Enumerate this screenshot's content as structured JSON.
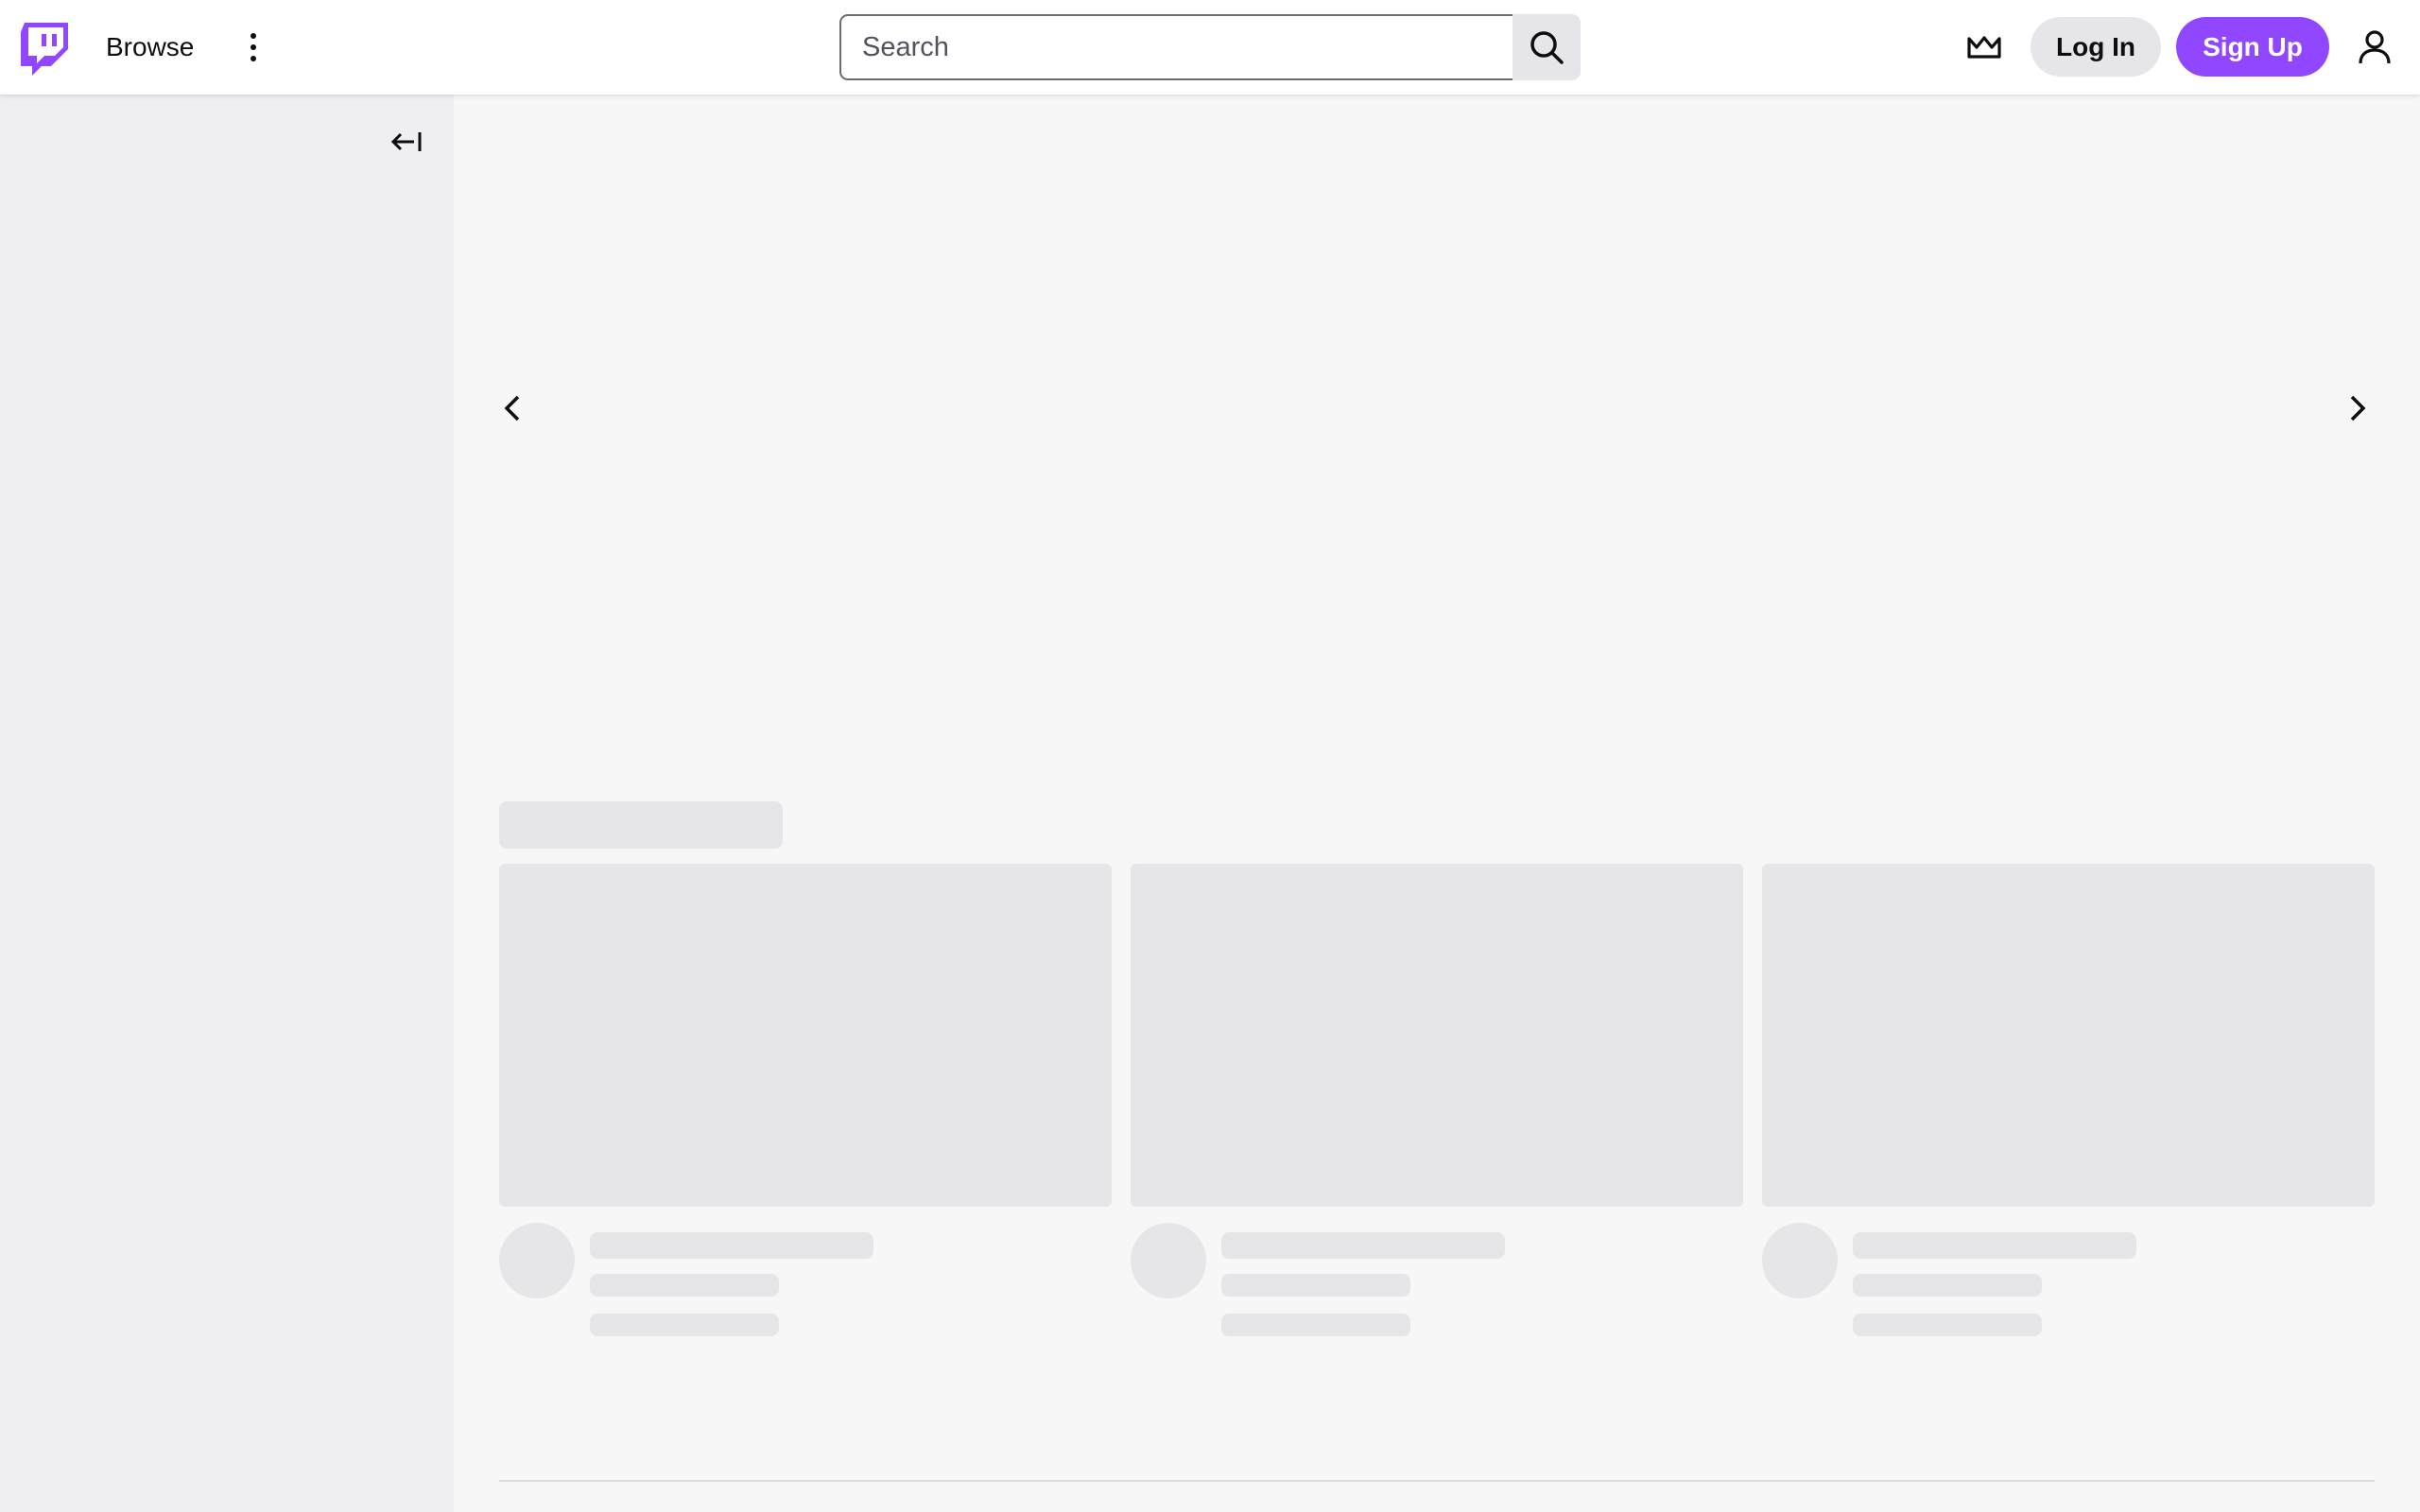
{
  "brand": {
    "accent": "#9147ff",
    "logo_icon": "twitch-logo-icon"
  },
  "header": {
    "browse_label": "Browse",
    "more_icon": "kebab-menu-icon",
    "search_placeholder": "Search",
    "search_value": "",
    "search_icon": "search-icon",
    "prime_icon": "crown-icon",
    "login_label": "Log In",
    "signup_label": "Sign Up",
    "user_icon": "user-icon"
  },
  "sidebar": {
    "collapse_icon": "collapse-left-icon"
  },
  "carousel": {
    "prev_icon": "chevron-left-icon",
    "next_icon": "chevron-right-icon"
  },
  "skeleton": {
    "card_count": 3
  }
}
